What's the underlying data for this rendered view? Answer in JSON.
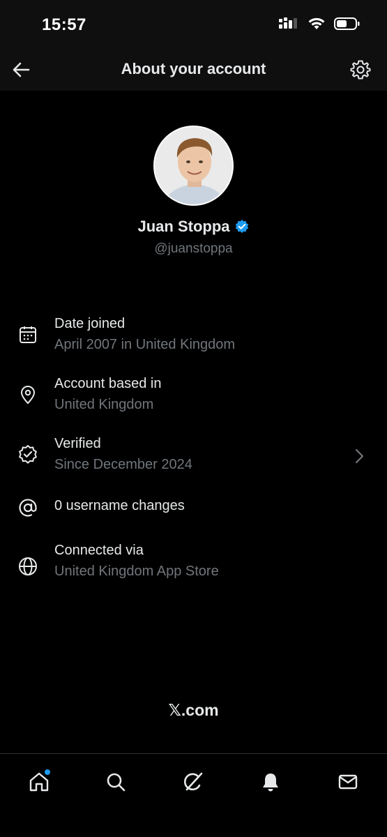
{
  "status_bar": {
    "time": "15:57",
    "icons": [
      "cellular-signal-icon",
      "wifi-icon",
      "battery-icon"
    ]
  },
  "header": {
    "title": "About your account",
    "back_icon": "arrow-left-icon",
    "settings_icon": "gear-icon"
  },
  "profile": {
    "name": "Juan Stoppa",
    "handle": "@juanstoppa",
    "verified": true,
    "verified_color": "#1d9bf0"
  },
  "info": {
    "date_joined": {
      "title": "Date joined",
      "value": "April 2007 in United Kingdom",
      "icon": "calendar-icon"
    },
    "based_in": {
      "title": "Account based in",
      "value": "United Kingdom",
      "icon": "location-pin-icon"
    },
    "verified": {
      "title": "Verified",
      "value": "Since December 2024",
      "icon": "verified-badge-icon"
    },
    "username_changes": {
      "title": "0 username changes",
      "icon": "at-sign-icon"
    },
    "connected_via": {
      "title": "Connected via",
      "value": "United Kingdom App Store",
      "icon": "globe-icon"
    }
  },
  "footer": {
    "brand": "𝕏.com"
  },
  "bottom_nav": {
    "items": [
      "home-icon",
      "search-icon",
      "grok-icon",
      "notifications-icon",
      "messages-icon"
    ],
    "home_badge_color": "#1d9bf0"
  },
  "colors": {
    "background": "#000000",
    "primary_text": "#e7e9ea",
    "secondary_text": "#71767b",
    "accent": "#1d9bf0"
  }
}
